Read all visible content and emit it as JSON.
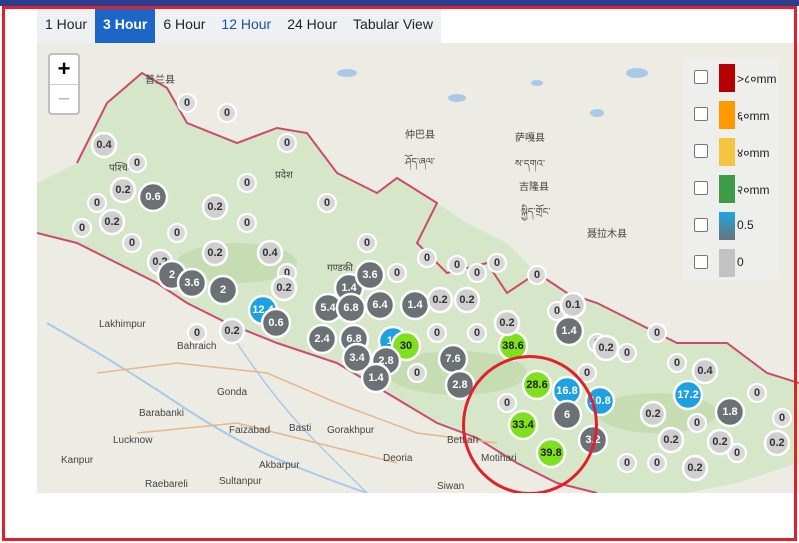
{
  "tabs": [
    {
      "label": "1 Hour",
      "state": "normal"
    },
    {
      "label": "3 Hour",
      "state": "active"
    },
    {
      "label": "6 Hour",
      "state": "normal"
    },
    {
      "label": "12 Hour",
      "state": "alt"
    },
    {
      "label": "24 Hour",
      "state": "normal"
    },
    {
      "label": "Tabular View",
      "state": "normal"
    }
  ],
  "zoom": {
    "in_label": "+",
    "out_label": "−"
  },
  "legend": [
    {
      "label": ">८०mm",
      "color": "#b50000"
    },
    {
      "label": "६०mm",
      "color": "#ff9900"
    },
    {
      "label": "४०mm",
      "color": "#f5c542"
    },
    {
      "label": "२०mm",
      "color": "#3d9a47"
    },
    {
      "label": "0.5",
      "color_top": "#1ea7e0",
      "color_bottom": "#67737c"
    },
    {
      "label": "0",
      "color": "#c2c2c2"
    }
  ],
  "colors": {
    "grey": "#6b7175",
    "light": "#c9c9c9",
    "blue": "#1fa0e0",
    "green": "#7ee01e",
    "border_red": "#e0202a",
    "nepal_fill": "#d6e6c8",
    "india_fill": "#ecebe4",
    "china_fill": "#ecebe4"
  },
  "places": [
    {
      "name": "普兰县"
    },
    {
      "name": "仲巴县"
    },
    {
      "name": "萨嘎县"
    },
    {
      "name": "吉隆县"
    },
    {
      "name": "聂拉木县"
    },
    {
      "name": "ཤོད་ཞལ་"
    },
    {
      "name": "ས་དགའ་"
    },
    {
      "name": "སྐྱིད་གྲོང་"
    },
    {
      "name": "Lakhimpur"
    },
    {
      "name": "Bahraich"
    },
    {
      "name": "Gonda"
    },
    {
      "name": "Barabanki"
    },
    {
      "name": "Faizabad"
    },
    {
      "name": "Basti"
    },
    {
      "name": "Gorakhpur"
    },
    {
      "name": "Lucknow"
    },
    {
      "name": "Akbarpur"
    },
    {
      "name": "Deoria"
    },
    {
      "name": "Kanpur"
    },
    {
      "name": "Raebareli"
    },
    {
      "name": "Sultanpur"
    },
    {
      "name": "Motihari"
    },
    {
      "name": "Bettiah"
    },
    {
      "name": "Siwan"
    },
    {
      "name": "पश्चिम"
    },
    {
      "name": "प्रदेश"
    },
    {
      "name": "गण्डकी"
    }
  ],
  "stations": [
    {
      "v": "0.4",
      "c": "light"
    },
    {
      "v": "0.2",
      "c": "light"
    },
    {
      "v": "0.6",
      "c": "grey"
    },
    {
      "v": "0.2",
      "c": "light"
    },
    {
      "v": "0.2",
      "c": "light"
    },
    {
      "v": "0.2",
      "c": "light"
    },
    {
      "v": "0.4",
      "c": "light"
    },
    {
      "v": "0.2",
      "c": "light"
    },
    {
      "v": "2",
      "c": "grey"
    },
    {
      "v": "3.6",
      "c": "grey"
    },
    {
      "v": "2",
      "c": "grey"
    },
    {
      "v": "12.4",
      "c": "blue"
    },
    {
      "v": "0.2",
      "c": "light"
    },
    {
      "v": "0.6",
      "c": "grey"
    },
    {
      "v": "0.2",
      "c": "light"
    },
    {
      "v": "1.4",
      "c": "grey"
    },
    {
      "v": "5.4",
      "c": "grey"
    },
    {
      "v": "6.8",
      "c": "grey"
    },
    {
      "v": "6.4",
      "c": "grey"
    },
    {
      "v": "1.4",
      "c": "grey"
    },
    {
      "v": "3.6",
      "c": "grey"
    },
    {
      "v": "0.2",
      "c": "light"
    },
    {
      "v": "0.2",
      "c": "light"
    },
    {
      "v": "2.4",
      "c": "grey"
    },
    {
      "v": "6.8",
      "c": "grey"
    },
    {
      "v": "3.4",
      "c": "grey"
    },
    {
      "v": "17",
      "c": "blue"
    },
    {
      "v": "30",
      "c": "green"
    },
    {
      "v": "2.8",
      "c": "grey"
    },
    {
      "v": "1.4",
      "c": "grey"
    },
    {
      "v": "7.6",
      "c": "grey"
    },
    {
      "v": "2.8",
      "c": "grey"
    },
    {
      "v": "38.6",
      "c": "green"
    },
    {
      "v": "0.2",
      "c": "light"
    },
    {
      "v": "1.4",
      "c": "grey"
    },
    {
      "v": "0.1",
      "c": "light"
    },
    {
      "v": "0.2",
      "c": "light"
    },
    {
      "v": "28.6",
      "c": "green"
    },
    {
      "v": "16.8",
      "c": "blue"
    },
    {
      "v": "6",
      "c": "grey"
    },
    {
      "v": "33.4",
      "c": "green"
    },
    {
      "v": "39.8",
      "c": "green"
    },
    {
      "v": "3.2",
      "c": "grey"
    },
    {
      "v": "10.8",
      "c": "blue"
    },
    {
      "v": "17.2",
      "c": "blue"
    },
    {
      "v": "1.8",
      "c": "grey"
    },
    {
      "v": "0.2",
      "c": "light"
    },
    {
      "v": "0.2",
      "c": "light"
    },
    {
      "v": "0.2",
      "c": "light"
    },
    {
      "v": "0.2",
      "c": "light"
    },
    {
      "v": "0.4",
      "c": "light"
    },
    {
      "v": "0.2",
      "c": "light"
    }
  ]
}
